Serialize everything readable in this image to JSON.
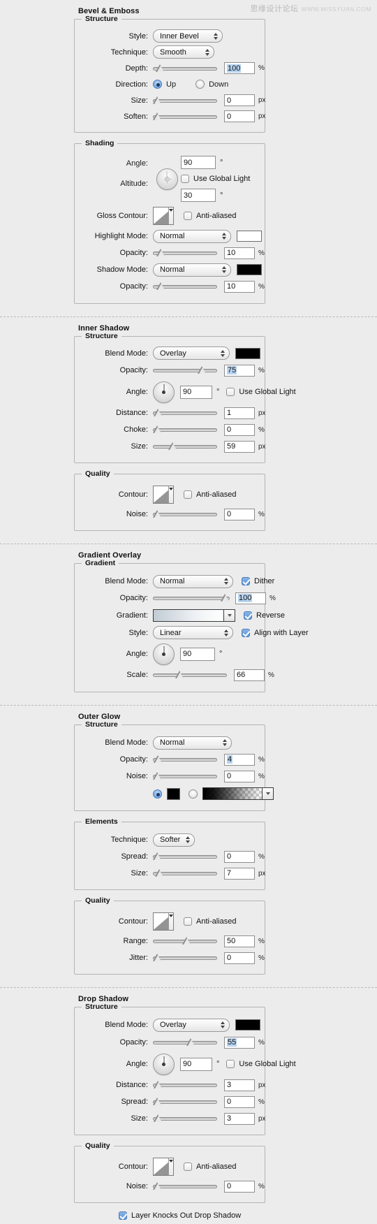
{
  "watermark": {
    "cn": "思缘设计论坛",
    "en": "WWW.MISSYUAN.COM"
  },
  "common": {
    "normal": "Normal",
    "overlay": "Overlay",
    "anti_aliased": "Anti-aliased",
    "use_global_light": "Use Global Light",
    "contour_label": "Contour:",
    "noise_label": "Noise:",
    "opacity_label": "Opacity:",
    "blend_mode_label": "Blend Mode:",
    "angle_label": "Angle:",
    "size_label": "Size:",
    "spread_label": "Spread:",
    "distance_label": "Distance:",
    "quality_legend": "Quality",
    "structure_legend": "Structure",
    "unit_percent": "%",
    "unit_px": "px",
    "unit_degree": "°"
  },
  "bevel": {
    "title": "Bevel & Emboss",
    "structure_legend": "Structure",
    "style_label": "Style:",
    "style_value": "Inner Bevel",
    "technique_label": "Technique:",
    "technique_value": "Smooth",
    "depth_label": "Depth:",
    "depth_value": "100",
    "depth_unit": "%",
    "direction_label": "Direction:",
    "direction_up": "Up",
    "direction_down": "Down",
    "direction_selected": "Up",
    "size_label": "Size:",
    "size_value": "0",
    "size_unit": "px",
    "soften_label": "Soften:",
    "soften_value": "0",
    "soften_unit": "px",
    "shading_legend": "Shading",
    "angle_label": "Angle:",
    "angle_value": "90",
    "angle_unit": "°",
    "use_global_light": "Use Global Light",
    "use_global_light_checked": false,
    "altitude_label": "Altitude:",
    "altitude_value": "30",
    "altitude_unit": "°",
    "gloss_contour_label": "Gloss Contour:",
    "anti_aliased": "Anti-aliased",
    "anti_aliased_checked": false,
    "highlight_mode_label": "Highlight Mode:",
    "highlight_mode_value": "Normal",
    "highlight_color": "#ffffff",
    "highlight_opacity_label": "Opacity:",
    "highlight_opacity_value": "10",
    "highlight_opacity_unit": "%",
    "shadow_mode_label": "Shadow Mode:",
    "shadow_mode_value": "Normal",
    "shadow_color": "#000000",
    "shadow_opacity_label": "Opacity:",
    "shadow_opacity_value": "10",
    "shadow_opacity_unit": "%"
  },
  "inner_shadow": {
    "title": "Inner Shadow",
    "structure_legend": "Structure",
    "blend_mode_label": "Blend Mode:",
    "blend_mode_value": "Overlay",
    "color": "#000000",
    "opacity_label": "Opacity:",
    "opacity_value": "75",
    "opacity_unit": "%",
    "angle_label": "Angle:",
    "angle_value": "90",
    "angle_unit": "°",
    "use_global_light": "Use Global Light",
    "use_global_light_checked": false,
    "distance_label": "Distance:",
    "distance_value": "1",
    "distance_unit": "px",
    "choke_label": "Choke:",
    "choke_value": "0",
    "choke_unit": "%",
    "size_label": "Size:",
    "size_value": "59",
    "size_unit": "px",
    "quality_legend": "Quality",
    "contour_label": "Contour:",
    "anti_aliased": "Anti-aliased",
    "anti_aliased_checked": false,
    "noise_label": "Noise:",
    "noise_value": "0",
    "noise_unit": "%"
  },
  "gradient_overlay": {
    "title": "Gradient Overlay",
    "gradient_legend": "Gradient",
    "blend_mode_label": "Blend Mode:",
    "blend_mode_value": "Normal",
    "dither_label": "Dither",
    "dither_checked": true,
    "opacity_label": "Opacity:",
    "opacity_value": "100",
    "opacity_unit": "%",
    "gradient_label": "Gradient:",
    "reverse_label": "Reverse",
    "reverse_checked": true,
    "style_label": "Style:",
    "style_value": "Linear",
    "align_label": "Align with Layer",
    "align_checked": true,
    "angle_label": "Angle:",
    "angle_value": "90",
    "angle_unit": "°",
    "scale_label": "Scale:",
    "scale_value": "66",
    "scale_unit": "%"
  },
  "outer_glow": {
    "title": "Outer Glow",
    "structure_legend": "Structure",
    "blend_mode_label": "Blend Mode:",
    "blend_mode_value": "Normal",
    "opacity_label": "Opacity:",
    "opacity_value": "4",
    "opacity_unit": "%",
    "noise_label": "Noise:",
    "noise_value": "0",
    "noise_unit": "%",
    "fill_type_selected": "color",
    "glow_color": "#000000",
    "elements_legend": "Elements",
    "technique_label": "Technique:",
    "technique_value": "Softer",
    "spread_label": "Spread:",
    "spread_value": "0",
    "spread_unit": "%",
    "size_label": "Size:",
    "size_value": "7",
    "size_unit": "px",
    "quality_legend": "Quality",
    "contour_label": "Contour:",
    "anti_aliased": "Anti-aliased",
    "anti_aliased_checked": false,
    "range_label": "Range:",
    "range_value": "50",
    "range_unit": "%",
    "jitter_label": "Jitter:",
    "jitter_value": "0",
    "jitter_unit": "%"
  },
  "drop_shadow": {
    "title": "Drop Shadow",
    "structure_legend": "Structure",
    "blend_mode_label": "Blend Mode:",
    "blend_mode_value": "Overlay",
    "color": "#000000",
    "opacity_label": "Opacity:",
    "opacity_value": "55",
    "opacity_unit": "%",
    "angle_label": "Angle:",
    "angle_value": "90",
    "angle_unit": "°",
    "use_global_light": "Use Global Light",
    "use_global_light_checked": false,
    "distance_label": "Distance:",
    "distance_value": "3",
    "distance_unit": "px",
    "spread_label": "Spread:",
    "spread_value": "0",
    "spread_unit": "%",
    "size_label": "Size:",
    "size_value": "3",
    "size_unit": "px",
    "quality_legend": "Quality",
    "contour_label": "Contour:",
    "anti_aliased": "Anti-aliased",
    "anti_aliased_checked": false,
    "noise_label": "Noise:",
    "noise_value": "0",
    "noise_unit": "%",
    "layer_knocks_out": "Layer Knocks Out Drop Shadow",
    "layer_knocks_out_checked": true
  }
}
